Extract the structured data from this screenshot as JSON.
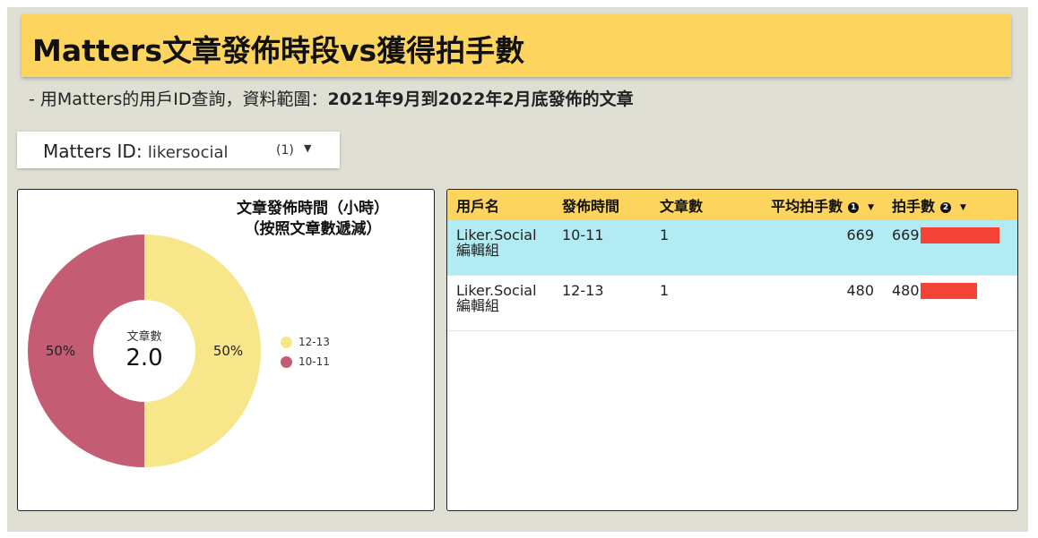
{
  "header": {
    "title": "Matters文章發佈時段vs獲得拍手數",
    "subtitle_prefix": "- 用Matters的用戶ID查詢，資料範圍：",
    "subtitle_bold": "2021年9月到2022年2月底發佈的文章"
  },
  "filter": {
    "label": "Matters ID",
    "value": "likersocial",
    "count": "(1)"
  },
  "chart_data": {
    "type": "pie",
    "title": "文章發佈時間（小時）",
    "subtitle": "（按照文章數遞減）",
    "center_label": "文章數",
    "center_value": "2.0",
    "slices": [
      {
        "label": "12-13",
        "value": 1,
        "percent": "50%",
        "color": "#f8e68a"
      },
      {
        "label": "10-11",
        "value": 1,
        "percent": "50%",
        "color": "#c45c74"
      }
    ]
  },
  "table": {
    "columns": [
      "用戶名",
      "發佈時間",
      "文章數",
      "平均拍手數",
      "拍手數"
    ],
    "column_badges": {
      "3": "1",
      "4": "2"
    },
    "max_claps": 669,
    "bar_color": "#f34336",
    "highlight_color": "#b2ebf2",
    "rows": [
      {
        "user": "Liker.Social",
        "user2": "編輯組",
        "time": "10-11",
        "articles": "1",
        "avg": "669",
        "claps": 669
      },
      {
        "user": "Liker.Social",
        "user2": "編輯組",
        "time": "12-13",
        "articles": "1",
        "avg": "480",
        "claps": 480
      }
    ]
  }
}
